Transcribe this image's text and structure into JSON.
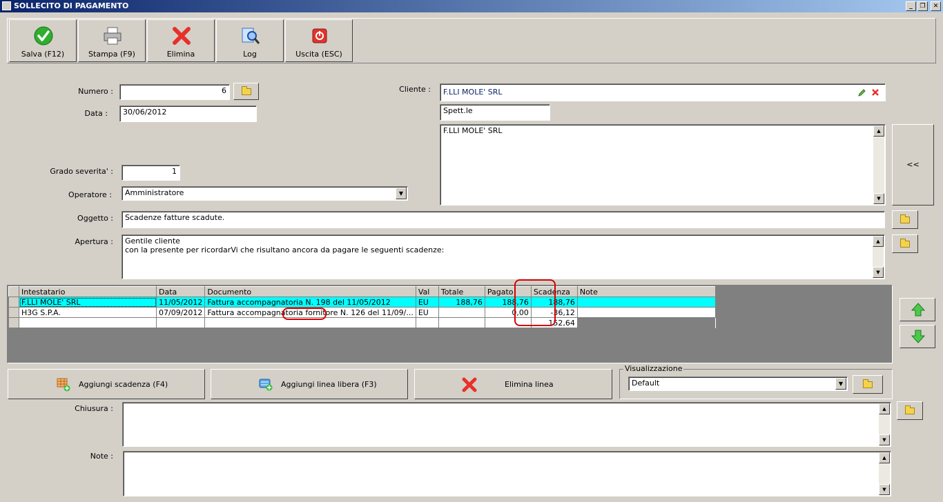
{
  "window": {
    "title": "SOLLECITO DI PAGAMENTO"
  },
  "toolbar": {
    "save": "Salva (F12)",
    "print": "Stampa (F9)",
    "delete": "Elimina",
    "log": "Log",
    "exit": "Uscita (ESC)"
  },
  "form": {
    "numero_label": "Numero :",
    "numero_value": "6",
    "data_label": "Data :",
    "data_value": "30/06/2012",
    "grado_label": "Grado severita' :",
    "grado_value": "1",
    "operatore_label": "Operatore :",
    "operatore_value": "Amministratore",
    "oggetto_label": "Oggetto :",
    "oggetto_value": "Scadenze fatture scadute.",
    "apertura_label": "Apertura :",
    "apertura_line1": "Gentile cliente",
    "apertura_line2": "con la presente per ricordarVi che risultano ancora da pagare le seguenti scadenze:",
    "cliente_label": "Cliente :",
    "cliente_value": "F.LLI MOLE' SRL",
    "spett_value": "Spett.le",
    "address_value": "F.LLI MOLE' SRL",
    "collapse_label": "<<",
    "chiusura_label": "Chiusura :",
    "note_label": "Note :"
  },
  "grid": {
    "columns": [
      "Intestatario",
      "Data",
      "Documento",
      "Val",
      "Totale",
      "Pagato",
      "Scadenza",
      "Note"
    ],
    "rows": [
      [
        "F.LLI MOLE' SRL",
        "11/05/2012",
        "Fattura accompagnatoria N. 198 del 11/05/2012",
        "EU",
        "188,76",
        "188,76",
        "188,76",
        ""
      ],
      [
        "H3G S.P.A.",
        "07/09/2012",
        "Fattura accompagnatoria fornitore N. 126 del 11/09/...",
        "EU",
        "",
        "0,00",
        "-36,12",
        ""
      ]
    ],
    "total": "152,64"
  },
  "actions": {
    "add_due": "Aggiungi scadenza (F4)",
    "add_free_line": "Aggiungi linea libera (F3)",
    "delete_line": "Elimina linea"
  },
  "view": {
    "label": "Visualizzazione",
    "value": "Default"
  }
}
